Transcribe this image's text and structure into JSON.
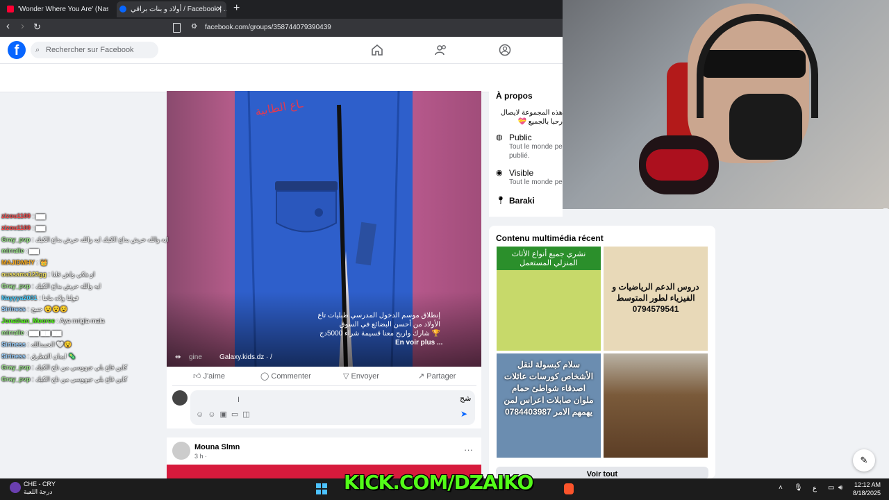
{
  "browser": {
    "tabs": [
      {
        "label": "'Wonder Where You Are' (Nasheed B",
        "icon": "youtube-icon"
      },
      {
        "label": "أولاد و بنات براقي / Facebook | ...ki",
        "icon": "facebook-icon",
        "active": true
      }
    ],
    "url": "facebook.com/groups/358744079390439"
  },
  "facebook": {
    "search_placeholder": "Rechercher sur Facebook",
    "colors": {
      "brand": "#0866ff",
      "background": "#f0f2f5"
    }
  },
  "post": {
    "overlay_text": [
      "إنطلاق موسم الدخول المدرسي طبليات تاع",
      "الأولاد من أحسن البضائع في السوق",
      "🏆 شارك واربح معنا قسيمة شراء 5000دج"
    ],
    "see_more": "En voir plus ...",
    "source_left": "gine",
    "source": "Galaxy.kids.dz · /",
    "actions": {
      "like": "J'aime",
      "comment": "Commenter",
      "send": "Envoyer",
      "share": "Partager"
    },
    "comment_text": "شج"
  },
  "post2": {
    "author": "Mouna Slmn",
    "time": "3 h ·"
  },
  "about": {
    "title": "À propos",
    "desc1": "هذه المجموعة لايصال",
    "desc2": "رحبا بالجميع 💝",
    "public_title": "Public",
    "public_desc1": "Tout le monde pe",
    "public_desc2": "publié.",
    "visible_title": "Visible",
    "visible_desc": "Tout le monde pe",
    "location": "Baraki"
  },
  "media_card": {
    "title": "Contenu multimédia récent",
    "see_all": "Voir tout",
    "thumbs": [
      {
        "text": "نشري جميع أنواع الأثاث المنزلي المستعمل",
        "bg": "#c7d96a"
      },
      {
        "text": "دروس الدعم الرياضيات و الفيزياء لطور المتوسط 0794579541",
        "bg": "#e8d9b8"
      },
      {
        "text": "سلام كبسولة لنقل الأشخاص كورسات عائلات اصدقاء شواطئ حمام ملوان صابلات اعراس لمن يهمهم الامر 0784403987",
        "bg": "#6b8db0"
      },
      {
        "text": "",
        "bg": "#7a5a3a"
      }
    ]
  },
  "chat": [
    {
      "user": "zizou1100",
      "msg": ": ▆▆",
      "color": "#ff4d4d"
    },
    {
      "user": "zizou1100",
      "msg": ": ▆▆",
      "color": "#ff4d4d"
    },
    {
      "user": "Gray_pvp",
      "msg": ": ايه والله حرش بداع الكيك ايه والله حرش بداع الكيك",
      "color": "#9be38a"
    },
    {
      "user": "mirralle",
      "msg": ": ▆▆",
      "color": "#9be38a"
    },
    {
      "user": "MAJIDMHY",
      "msg": ": 👑",
      "color": "#ffb020"
    },
    {
      "user": "oussama123gg",
      "msg": ": او هكي واش قلنا",
      "color": "#f0e060"
    },
    {
      "user": "Gray_pvp",
      "msg": ": ايه والله حرش بداع الكيك",
      "color": "#9be38a"
    },
    {
      "user": "Nayyya2001",
      "msg": ": قولنا ولاه ماتنا",
      "color": "#50d0ff"
    },
    {
      "user": "Siriness",
      "msg": ": جنيح 😵😵😵",
      "color": "#9bd1ff"
    },
    {
      "user": "Jonathan_Mooree",
      "msg": ": Aya mrigla mala",
      "color": "#53fc18"
    },
    {
      "user": "mirralle",
      "msg": ": ▆▆ ▆▆ ▆▆",
      "color": "#9be38a"
    },
    {
      "user": "Siriness",
      "msg": ": الحمدالله 🤍😵",
      "color": "#9bd1ff"
    },
    {
      "user": "Siriness",
      "msg": ": ايمان القطرق 🦠",
      "color": "#9bd1ff"
    },
    {
      "user": "Gray_pvp",
      "msg": ": كاين قاع بلي جيهوسي من تاج الكيك",
      "color": "#9be38a"
    },
    {
      "user": "Gray_pvp",
      "msg": ": كاين قاع بلي جيهوسي من تاج الكيك",
      "color": "#9be38a"
    }
  ],
  "overlay": {
    "kick": "KICK.COM/DZAIKO"
  },
  "taskbar": {
    "weather_line1": "CHE - CRY",
    "weather_line2": "درجة اللعبة",
    "time": "12:12 AM",
    "date": "8/18/2025",
    "lang": "ع"
  }
}
